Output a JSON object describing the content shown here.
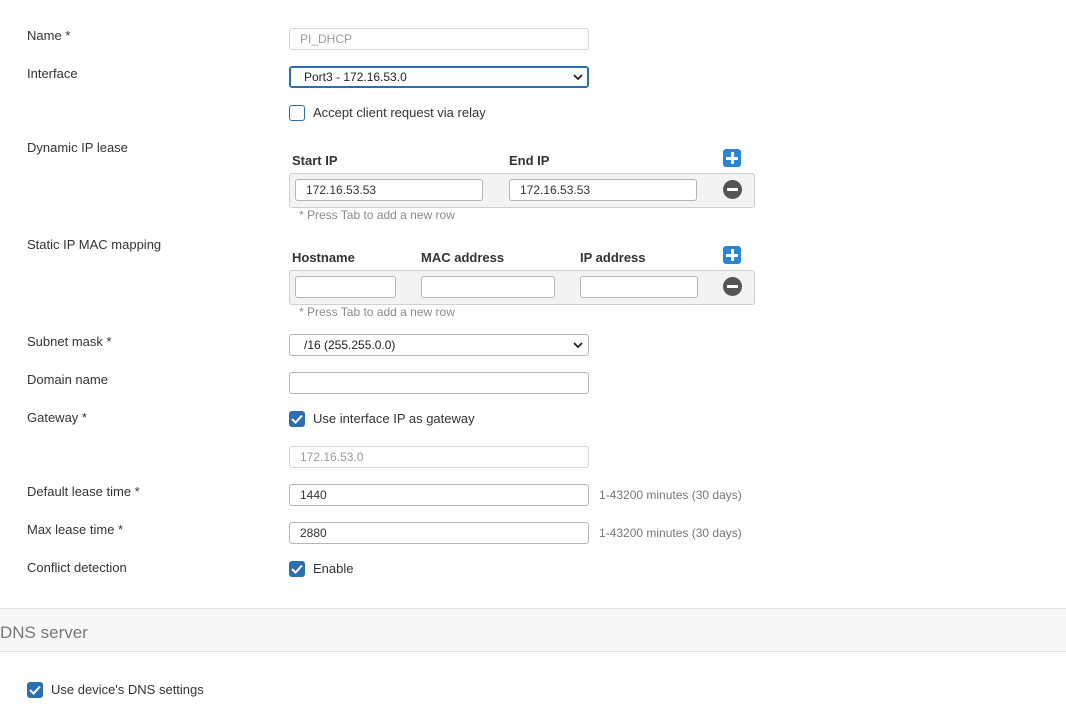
{
  "fields": {
    "name": {
      "label": "Name *",
      "value": "PI_DHCP"
    },
    "interface": {
      "label": "Interface",
      "value": "Port3 - 172.16.53.0"
    },
    "relay": {
      "label": "Accept client request via relay",
      "checked": false
    },
    "dynamic_ip_lease": {
      "label": "Dynamic IP lease",
      "columns": [
        "Start IP",
        "End IP"
      ],
      "row": {
        "start_ip": "172.16.53.53",
        "end_ip": "172.16.53.53"
      },
      "hint": "* Press Tab to add a new row"
    },
    "static_mapping": {
      "label": "Static IP MAC mapping",
      "columns": [
        "Hostname",
        "MAC address",
        "IP address"
      ],
      "row": {
        "hostname": "",
        "mac": "",
        "ip": ""
      },
      "hint": "* Press Tab to add a new row"
    },
    "subnet_mask": {
      "label": "Subnet mask *",
      "value": "/16 (255.255.0.0)"
    },
    "domain_name": {
      "label": "Domain name",
      "value": ""
    },
    "gateway": {
      "label": "Gateway *",
      "checkbox_label": "Use interface IP as gateway",
      "checked": true,
      "value": "172.16.53.0"
    },
    "default_lease": {
      "label": "Default lease time *",
      "value": "1440",
      "hint": "1-43200 minutes (30 days)"
    },
    "max_lease": {
      "label": "Max lease time *",
      "value": "2880",
      "hint": "1-43200 minutes (30 days)"
    },
    "conflict_detection": {
      "label": "Conflict detection",
      "checkbox_label": "Enable",
      "checked": true
    }
  },
  "dns_section": {
    "title": "DNS server",
    "use_device_dns": {
      "label": "Use device's DNS settings",
      "checked": true
    }
  },
  "icons": {
    "add": "plus-icon",
    "remove": "minus-circle-icon",
    "checkmark": "checkmark-icon",
    "dropdown": "chevron-down-icon"
  },
  "colors": {
    "accent": "#2a6fb0",
    "add_button": "#2a86d4",
    "remove_button": "#555555",
    "text": "#333333",
    "hint": "#8a8a8a"
  }
}
